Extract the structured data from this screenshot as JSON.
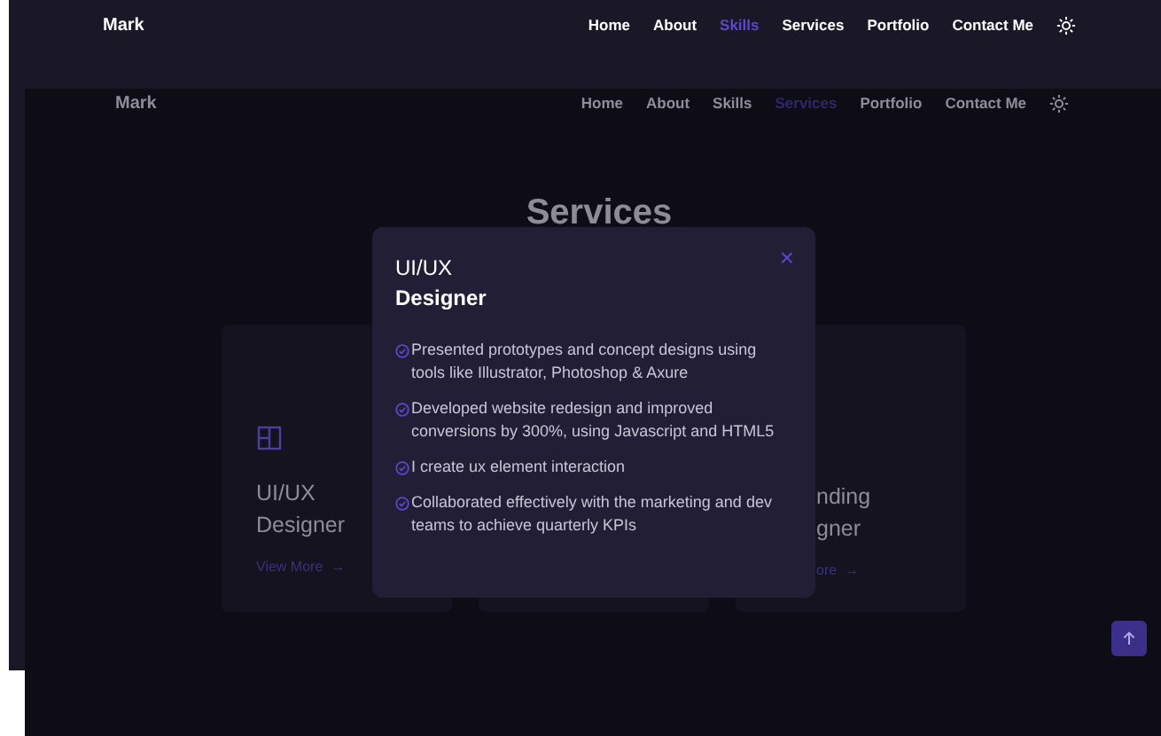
{
  "back_page": {
    "brand": "Mark",
    "nav": [
      {
        "label": "Home",
        "selected": false
      },
      {
        "label": "About",
        "selected": false
      },
      {
        "label": "Skills",
        "selected": true
      },
      {
        "label": "Services",
        "selected": false
      },
      {
        "label": "Portfolio",
        "selected": false
      },
      {
        "label": "Contact Me",
        "selected": false
      }
    ]
  },
  "front_page": {
    "brand": "Mark",
    "heading": "Services",
    "nav": [
      {
        "label": "Home",
        "selected": false
      },
      {
        "label": "About",
        "selected": false
      },
      {
        "label": "Skills",
        "selected": false
      },
      {
        "label": "Services",
        "selected": true
      },
      {
        "label": "Portfolio",
        "selected": false
      },
      {
        "label": "Contact Me",
        "selected": false
      }
    ],
    "cards": [
      {
        "kind": "icon",
        "title_lines": [
          "UI/UX",
          "Designer"
        ],
        "link": "View More",
        "link_arrow": "→"
      },
      {
        "kind": "covered"
      },
      {
        "kind": "clipped",
        "title_lines": [
          "nding",
          "gner"
        ],
        "link": "ore",
        "link_arrow": "→"
      }
    ]
  },
  "modal": {
    "title_lines": [
      "UI/UX",
      "Designer"
    ],
    "close": "×",
    "items": [
      "Presented prototypes and concept designs using tools like Illustrator, Photoshop & Axure",
      "Developed website redesign and improved conversions by 300%, using Javascript and HTML5",
      "I create ux element interaction",
      "Collaborated effectively with the marketing and dev teams to achieve quarterly KPIs"
    ]
  }
}
